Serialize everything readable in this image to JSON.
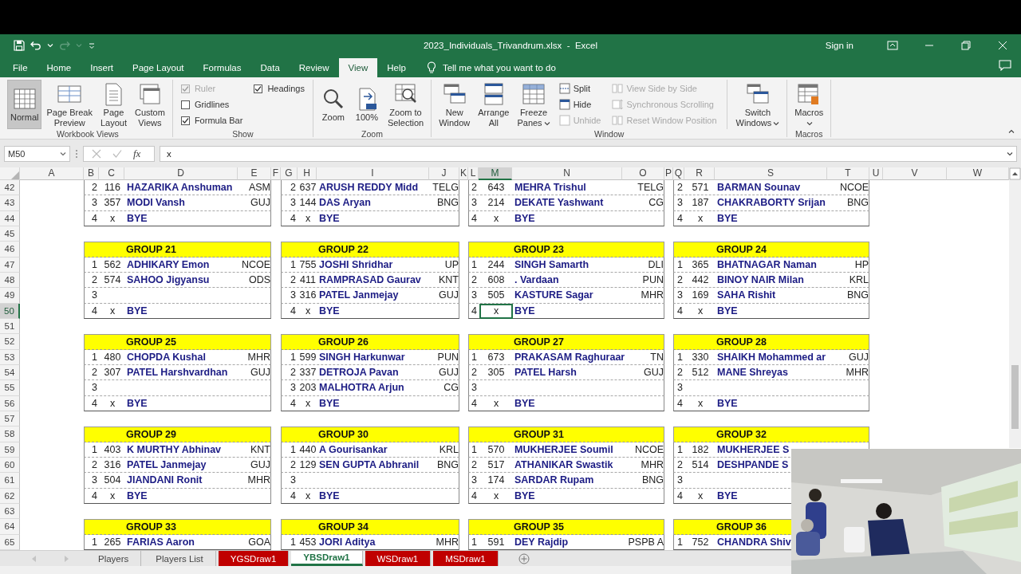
{
  "window": {
    "title": "2023_Individuals_Trivandrum.xlsx  -  Excel",
    "sign_in": "Sign in"
  },
  "ribbon_tabs": [
    {
      "label": "File",
      "selected": false
    },
    {
      "label": "Home",
      "selected": false
    },
    {
      "label": "Insert",
      "selected": false
    },
    {
      "label": "Page Layout",
      "selected": false
    },
    {
      "label": "Formulas",
      "selected": false
    },
    {
      "label": "Data",
      "selected": false
    },
    {
      "label": "Review",
      "selected": false
    },
    {
      "label": "View",
      "selected": true
    },
    {
      "label": "Help",
      "selected": false
    }
  ],
  "tell_me": "Tell me what you want to do",
  "ribbon_groups": [
    {
      "label": "Workbook Views",
      "items": [
        {
          "kind": "large",
          "label": "Normal",
          "selected": true
        },
        {
          "kind": "large",
          "label": "Page Break Preview",
          "selected": false
        },
        {
          "kind": "large",
          "label": "Page Layout",
          "selected": false
        },
        {
          "kind": "large",
          "label": "Custom Views",
          "selected": false
        }
      ]
    },
    {
      "label": "Show",
      "items": [
        {
          "kind": "check",
          "label": "Ruler",
          "checked": true,
          "disabled": true
        },
        {
          "kind": "check",
          "label": "Gridlines",
          "checked": false,
          "disabled": false
        },
        {
          "kind": "check",
          "label": "Formula Bar",
          "checked": true,
          "disabled": false
        },
        {
          "kind": "check",
          "label": "Headings",
          "checked": true,
          "disabled": false
        }
      ]
    },
    {
      "label": "Zoom",
      "items": [
        {
          "kind": "large",
          "label": "Zoom"
        },
        {
          "kind": "large",
          "label": "100%"
        },
        {
          "kind": "large",
          "label": "Zoom to Selection"
        }
      ]
    },
    {
      "label": "Window",
      "items": [
        {
          "kind": "large",
          "label": "New Window"
        },
        {
          "kind": "large",
          "label": "Arrange All"
        },
        {
          "kind": "large",
          "label": "Freeze Panes",
          "dropdown": true
        },
        {
          "kind": "small",
          "label": "Split",
          "disabled": false
        },
        {
          "kind": "small",
          "label": "Hide",
          "disabled": false
        },
        {
          "kind": "small",
          "label": "Unhide",
          "disabled": true
        },
        {
          "kind": "small",
          "label": "View Side by Side",
          "disabled": true
        },
        {
          "kind": "small",
          "label": "Synchronous Scrolling",
          "disabled": true
        },
        {
          "kind": "small",
          "label": "Reset Window Position",
          "disabled": true
        },
        {
          "kind": "large",
          "label": "Switch Windows",
          "dropdown": true
        }
      ]
    },
    {
      "label": "Macros",
      "items": [
        {
          "kind": "large",
          "label": "Macros",
          "dropdown": true
        }
      ]
    }
  ],
  "formula_bar": {
    "name_box": "M50",
    "function_label": "fx",
    "value": "x"
  },
  "sheet": {
    "columns": [
      {
        "letter": "A",
        "selected": false
      },
      {
        "letter": "B",
        "selected": false
      },
      {
        "letter": "C",
        "selected": false
      },
      {
        "letter": "D",
        "selected": false
      },
      {
        "letter": "E",
        "selected": false
      },
      {
        "letter": "F",
        "selected": false
      },
      {
        "letter": "G",
        "selected": false
      },
      {
        "letter": "H",
        "selected": false
      },
      {
        "letter": "I",
        "selected": false
      },
      {
        "letter": "J",
        "selected": false
      },
      {
        "letter": "K",
        "selected": false
      },
      {
        "letter": "L",
        "selected": false
      },
      {
        "letter": "M",
        "selected": true
      },
      {
        "letter": "N",
        "selected": false
      },
      {
        "letter": "O",
        "selected": false
      },
      {
        "letter": "P",
        "selected": false
      },
      {
        "letter": "Q",
        "selected": false
      },
      {
        "letter": "R",
        "selected": false
      },
      {
        "letter": "S",
        "selected": false
      },
      {
        "letter": "T",
        "selected": false
      },
      {
        "letter": "U",
        "selected": false
      },
      {
        "letter": "V",
        "selected": false
      },
      {
        "letter": "W",
        "selected": false
      }
    ],
    "rows": [
      {
        "number": "42",
        "selected": false
      },
      {
        "number": "43",
        "selected": false
      },
      {
        "number": "44",
        "selected": false
      },
      {
        "number": "45",
        "selected": false
      },
      {
        "number": "46",
        "selected": false
      },
      {
        "number": "47",
        "selected": false
      },
      {
        "number": "48",
        "selected": false
      },
      {
        "number": "49",
        "selected": false
      },
      {
        "number": "50",
        "selected": true
      },
      {
        "number": "51",
        "selected": false
      },
      {
        "number": "52",
        "selected": false
      },
      {
        "number": "53",
        "selected": false
      },
      {
        "number": "54",
        "selected": false
      },
      {
        "number": "55",
        "selected": false
      },
      {
        "number": "56",
        "selected": false
      },
      {
        "number": "57",
        "selected": false
      },
      {
        "number": "58",
        "selected": false
      },
      {
        "number": "59",
        "selected": false
      },
      {
        "number": "60",
        "selected": false
      },
      {
        "number": "61",
        "selected": false
      },
      {
        "number": "62",
        "selected": false
      },
      {
        "number": "63",
        "selected": false
      },
      {
        "number": "64",
        "selected": false
      },
      {
        "number": "65",
        "selected": false
      }
    ],
    "blocks": [
      {
        "groups": [
          {
            "entries": [
              {
                "seed": "2",
                "id": "116",
                "name": "HAZARIKA Anshuman",
                "state": "ASM"
              },
              {
                "seed": "3",
                "id": "357",
                "name": "MODI Vansh",
                "state": "GUJ"
              },
              {
                "seed": "4",
                "id": "x",
                "name": "BYE"
              }
            ]
          },
          {
            "entries": [
              {
                "seed": "2",
                "id": "637",
                "name": "ARUSH REDDY Midd",
                "state": "TELG"
              },
              {
                "seed": "3",
                "id": "144",
                "name": "DAS Aryan",
                "state": "BNG"
              },
              {
                "seed": "4",
                "id": "x",
                "name": "BYE"
              }
            ]
          },
          {
            "entries": [
              {
                "seed": "2",
                "id": "643",
                "name": "MEHRA Trishul",
                "state": "TELG"
              },
              {
                "seed": "3",
                "id": "214",
                "name": "DEKATE Yashwant",
                "state": "CG"
              },
              {
                "seed": "4",
                "id": "x",
                "name": "BYE"
              }
            ]
          },
          {
            "entries": [
              {
                "seed": "2",
                "id": "571",
                "name": "BARMAN Sounav",
                "state": "NCOE"
              },
              {
                "seed": "3",
                "id": "187",
                "name": "CHAKRABORTY Srijan",
                "state": "BNG"
              },
              {
                "seed": "4",
                "id": "x",
                "name": "BYE"
              }
            ]
          }
        ]
      },
      {
        "groups": [
          {
            "title": "GROUP 21",
            "entries": [
              {
                "seed": "1",
                "id": "562",
                "name": "ADHIKARY Emon",
                "state": "NCOE"
              },
              {
                "seed": "2",
                "id": "574",
                "name": "SAHOO Jigyansu",
                "state": "ODS"
              },
              {
                "seed": "3"
              },
              {
                "seed": "4",
                "id": "x",
                "name": "BYE"
              }
            ]
          },
          {
            "title": "GROUP 22",
            "entries": [
              {
                "seed": "1",
                "id": "755",
                "name": "JOSHI Shridhar",
                "state": "UP"
              },
              {
                "seed": "2",
                "id": "411",
                "name": "RAMPRASAD Gaurav",
                "state": "KNT"
              },
              {
                "seed": "3",
                "id": "316",
                "name": "PATEL Janmejay",
                "state": "GUJ"
              },
              {
                "seed": "4",
                "id": "x",
                "name": "BYE"
              }
            ]
          },
          {
            "title": "GROUP 23",
            "entries": [
              {
                "seed": "1",
                "id": "244",
                "name": "SINGH Samarth",
                "state": "DLI"
              },
              {
                "seed": "2",
                "id": "608",
                "name": ". Vardaan",
                "state": "PUN"
              },
              {
                "seed": "3",
                "id": "505",
                "name": "KASTURE Sagar",
                "state": "MHR"
              },
              {
                "seed": "4",
                "id": "x",
                "name": "BYE"
              }
            ]
          },
          {
            "title": "GROUP 24",
            "entries": [
              {
                "seed": "1",
                "id": "365",
                "name": "BHATNAGAR Naman",
                "state": "HP"
              },
              {
                "seed": "2",
                "id": "442",
                "name": "BINOY NAIR Milan",
                "state": "KRL"
              },
              {
                "seed": "3",
                "id": "169",
                "name": "SAHA Rishit",
                "state": "BNG"
              },
              {
                "seed": "4",
                "id": "x",
                "name": "BYE"
              }
            ]
          }
        ]
      },
      {
        "groups": [
          {
            "title": "GROUP 25",
            "entries": [
              {
                "seed": "1",
                "id": "480",
                "name": "CHOPDA Kushal",
                "state": "MHR"
              },
              {
                "seed": "2",
                "id": "307",
                "name": "PATEL Harshvardhan",
                "state": "GUJ"
              },
              {
                "seed": "3"
              },
              {
                "seed": "4",
                "id": "x",
                "name": "BYE"
              }
            ]
          },
          {
            "title": "GROUP 26",
            "entries": [
              {
                "seed": "1",
                "id": "599",
                "name": "SINGH Harkunwar",
                "state": "PUN"
              },
              {
                "seed": "2",
                "id": "337",
                "name": "DETROJA Pavan",
                "state": "GUJ"
              },
              {
                "seed": "3",
                "id": "203",
                "name": "MALHOTRA Arjun",
                "state": "CG"
              },
              {
                "seed": "4",
                "id": "x",
                "name": "BYE"
              }
            ]
          },
          {
            "title": "GROUP 27",
            "entries": [
              {
                "seed": "1",
                "id": "673",
                "name": "PRAKASAM Raghuraar",
                "state": "TN"
              },
              {
                "seed": "2",
                "id": "305",
                "name": "PATEL Harsh",
                "state": "GUJ"
              },
              {
                "seed": "3"
              },
              {
                "seed": "4",
                "id": "x",
                "name": "BYE"
              }
            ]
          },
          {
            "title": "GROUP 28",
            "entries": [
              {
                "seed": "1",
                "id": "330",
                "name": "SHAIKH Mohammed ar",
                "state": "GUJ"
              },
              {
                "seed": "2",
                "id": "512",
                "name": "MANE Shreyas",
                "state": "MHR"
              },
              {
                "seed": "3"
              },
              {
                "seed": "4",
                "id": "x",
                "name": "BYE"
              }
            ]
          }
        ]
      },
      {
        "groups": [
          {
            "title": "GROUP 29",
            "entries": [
              {
                "seed": "1",
                "id": "403",
                "name": "K MURTHY Abhinav",
                "state": "KNT"
              },
              {
                "seed": "2",
                "id": "316",
                "name": "PATEL Janmejay",
                "state": "GUJ"
              },
              {
                "seed": "3",
                "id": "504",
                "name": "JIANDANI Ronit",
                "state": "MHR"
              },
              {
                "seed": "4",
                "id": "x",
                "name": "BYE"
              }
            ]
          },
          {
            "title": "GROUP 30",
            "entries": [
              {
                "seed": "1",
                "id": "440",
                "name": "A Gourisankar",
                "state": "KRL"
              },
              {
                "seed": "2",
                "id": "129",
                "name": "SEN GUPTA Abhranil",
                "state": "BNG"
              },
              {
                "seed": "3"
              },
              {
                "seed": "4",
                "id": "x",
                "name": "BYE"
              }
            ]
          },
          {
            "title": "GROUP 31",
            "entries": [
              {
                "seed": "1",
                "id": "570",
                "name": "MUKHERJEE Soumil",
                "state": "NCOE"
              },
              {
                "seed": "2",
                "id": "517",
                "name": "ATHANIKAR Swastik",
                "state": "MHR"
              },
              {
                "seed": "3",
                "id": "174",
                "name": "SARDAR Rupam",
                "state": "BNG"
              },
              {
                "seed": "4",
                "id": "x",
                "name": "BYE"
              }
            ]
          },
          {
            "title": "GROUP 32",
            "entries": [
              {
                "seed": "1",
                "id": "182",
                "name": "MUKHERJEE S"
              },
              {
                "seed": "2",
                "id": "514",
                "name": "DESHPANDE S"
              },
              {
                "seed": "3"
              },
              {
                "seed": "4",
                "id": "x",
                "name": "BYE"
              }
            ]
          }
        ]
      },
      {
        "groups": [
          {
            "title": "GROUP 33",
            "entries": [
              {
                "seed": "1",
                "id": "265",
                "name": "FARIAS Aaron",
                "state": "GOA"
              }
            ]
          },
          {
            "title": "GROUP 34",
            "entries": [
              {
                "seed": "1",
                "id": "453",
                "name": "JORI Aditya",
                "state": "MHR"
              }
            ]
          },
          {
            "title": "GROUP 35",
            "entries": [
              {
                "seed": "1",
                "id": "591",
                "name": "DEY Rajdip",
                "state": "PSPB A"
              }
            ]
          },
          {
            "title": "GROUP 36",
            "entries": [
              {
                "seed": "1",
                "id": "752",
                "name": "CHANDRA Shiv"
              }
            ]
          }
        ]
      }
    ]
  },
  "sheet_tabs": [
    {
      "label": "Players",
      "selected": false
    },
    {
      "label": "Players List",
      "selected": false
    },
    {
      "label": "YGSDraw1",
      "selected": false,
      "color": "#c00000"
    },
    {
      "label": "YBSDraw1",
      "selected": true
    },
    {
      "label": "WSDraw1",
      "selected": false,
      "color": "#c00000"
    },
    {
      "label": "MSDraw1",
      "selected": false,
      "color": "#c00000"
    }
  ]
}
